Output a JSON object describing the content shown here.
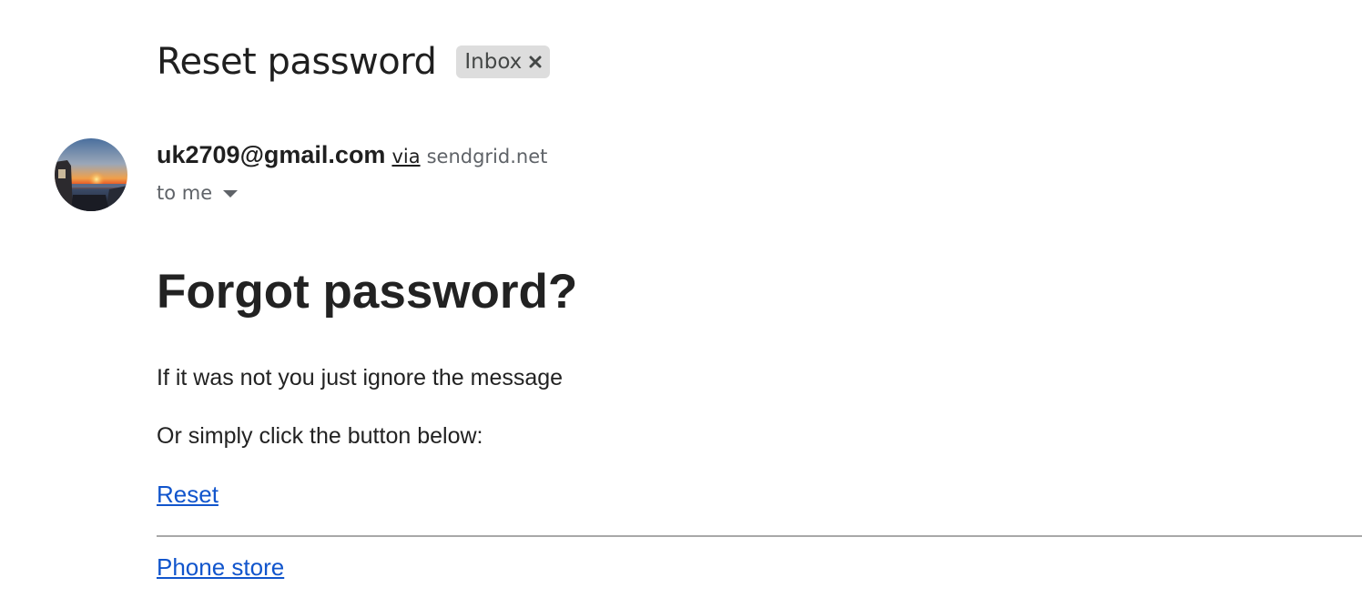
{
  "email": {
    "subject": "Reset password",
    "label_chip": {
      "text": "Inbox",
      "close_icon": "close-icon"
    },
    "sender": {
      "email": "uk2709@gmail.com",
      "via_label": "via",
      "via_domain": "sendgrid.net",
      "recipient_text": "to me",
      "recipient_icon": "chevron-down-icon",
      "avatar": "avatar-sunset-photo"
    },
    "body": {
      "heading": "Forgot password?",
      "paragraph_1": "If it was not you just ignore the message",
      "paragraph_2": "Or simply click the button below:",
      "reset_link": "Reset",
      "footer_link": "Phone store"
    }
  },
  "colors": {
    "link": "#1155cc",
    "chip_bg": "#dddddd",
    "secondary_text": "#5f6368"
  }
}
